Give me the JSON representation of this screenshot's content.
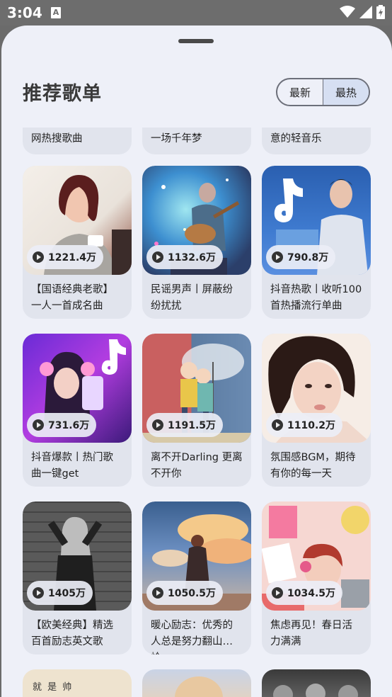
{
  "status_bar": {
    "time": "3:04",
    "notification_badge": "A"
  },
  "header": {
    "title": "推荐歌单",
    "tab_latest": "最新",
    "tab_hottest": "最热",
    "active_tab": "最热"
  },
  "partial_row": [
    {
      "title": "网热搜歌曲"
    },
    {
      "title": "一场千年梦"
    },
    {
      "title": "意的轻音乐"
    }
  ],
  "playlists": [
    {
      "plays": "1221.4万",
      "title": "【国语经典老歌】一人一首成名曲",
      "cover": "woman-portrait"
    },
    {
      "plays": "1132.6万",
      "title": "民谣男声丨屏蔽纷纷扰扰",
      "cover": "guitar-illustration"
    },
    {
      "plays": "790.8万",
      "title": "抖音热歌丨收听100首热播流行单曲",
      "cover": "tiktok-singer"
    },
    {
      "plays": "731.6万",
      "title": "抖音爆款丨热门歌曲一键get",
      "cover": "tiktok-girl"
    },
    {
      "plays": "1191.5万",
      "title": "离不开Darling 更离不开你",
      "cover": "couple-umbrella"
    },
    {
      "plays": "1110.2万",
      "title": "氛围感BGM，期待有你的每一天",
      "cover": "girl-closeup"
    },
    {
      "plays": "1405万",
      "title": "【欧美经典】精选百首励志英文歌",
      "cover": "bw-woman-wall"
    },
    {
      "plays": "1050.5万",
      "title": "暖心励志：优秀的人总是努力翻山越岭",
      "cover": "clouds-girl"
    },
    {
      "plays": "1034.5万",
      "title": "焦虑再见！春日活力满满",
      "cover": "pink-illustration"
    }
  ],
  "peek_row": [
    {
      "cover_text": "就 是 帅"
    },
    {
      "cover_text": ""
    },
    {
      "cover_text": ""
    }
  ],
  "colors": {
    "sheet_background": "#eef0f8",
    "card_background": "#e1e4ed",
    "active_tab_background": "#d6dff2",
    "status_bar": "#6d6d6d"
  }
}
